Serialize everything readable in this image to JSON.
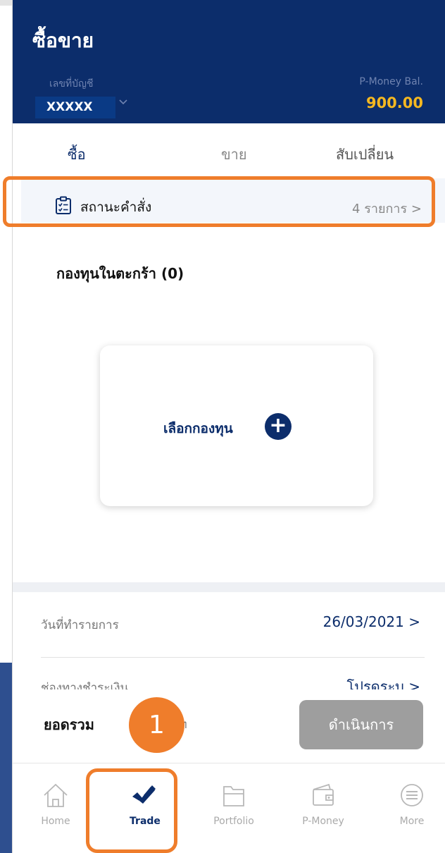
{
  "header": {
    "title": "ซื้อขาย",
    "account_label": "เลขที่บัญชี",
    "account_number": "XXXXX",
    "balance_label": "P-Money Bal.",
    "balance_value": "900.00"
  },
  "tabs": [
    {
      "label": "ซื้อ",
      "active": true
    },
    {
      "label": "ขาย",
      "active": false
    },
    {
      "label": "สับเปลี่ยน",
      "active": false
    }
  ],
  "order_status": {
    "label": "สถานะคำสั่ง",
    "count": "4 รายการ >"
  },
  "cart": {
    "title": "กองทุนในตะกร้า (0)",
    "select_label": "เลือกกองทุน",
    "plus_symbol": "+"
  },
  "details": {
    "date_label": "วันที่ทำรายการ",
    "date_value": "26/03/2021 >",
    "payment_label": "ช่องทางชำระเงิน",
    "payment_value": "โปรดระบุ >"
  },
  "footer": {
    "total_label": "ยอดรวม",
    "total_unit": "าท",
    "proceed_label": "ดำเนินการ"
  },
  "annotation": {
    "step_number": "1"
  },
  "bottom_nav": [
    {
      "label": "Home",
      "icon": "home-icon",
      "active": false
    },
    {
      "label": "Trade",
      "icon": "trade-icon",
      "active": true
    },
    {
      "label": "Portfolio",
      "icon": "folder-icon",
      "active": false
    },
    {
      "label": "P-Money",
      "icon": "wallet-icon",
      "active": false
    },
    {
      "label": "More",
      "icon": "menu-icon",
      "active": false
    }
  ],
  "colors": {
    "brand_navy": "#0c2d6b",
    "balance_gold": "#f5b821",
    "highlight_orange": "#ef7d2b",
    "disabled_gray": "#9e9e9e"
  }
}
